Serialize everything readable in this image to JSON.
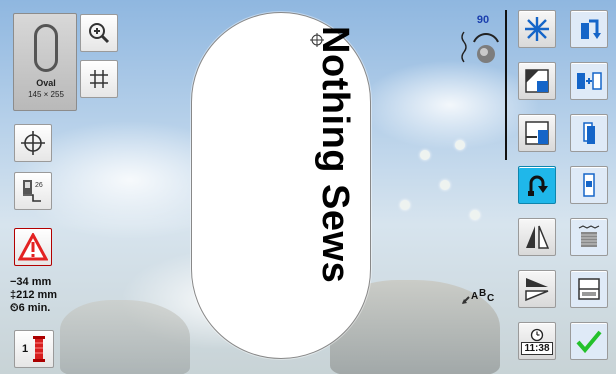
{
  "hoop": {
    "name": "Oval",
    "size": "145 × 255",
    "design_text": "Nothing Sews"
  },
  "info": {
    "x_offset": "−34 mm",
    "y_offset": "‡212 mm",
    "time": "⏲6 min.",
    "color_count": "1"
  },
  "dial": {
    "value": "90"
  },
  "status": {
    "clock": "11:38"
  },
  "colors": {
    "accent": "#1fb7ea",
    "warning": "#e32222",
    "confirm": "#24c12b",
    "icon_blue": "#1565c8"
  }
}
